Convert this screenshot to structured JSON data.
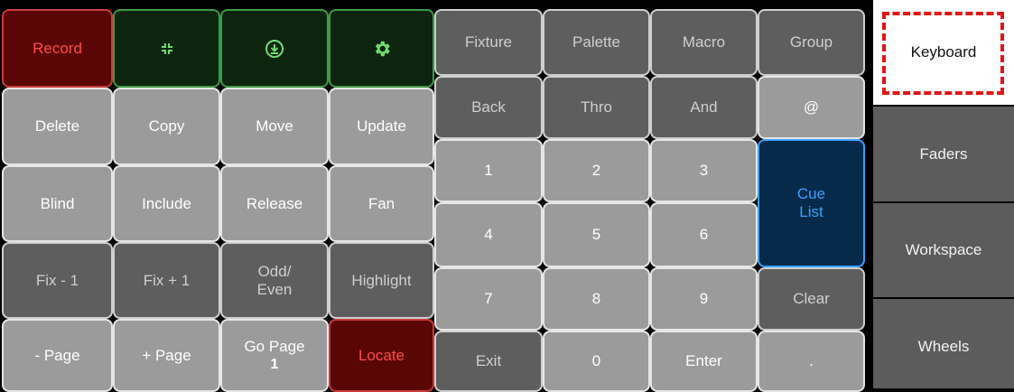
{
  "left_grid": {
    "row1": {
      "record_label": "Record",
      "icon1": "compress-icon",
      "icon2": "download-circle-icon",
      "icon3": "gear-icon"
    },
    "row2": [
      "Delete",
      "Copy",
      "Move",
      "Update"
    ],
    "row3": [
      "Blind",
      "Include",
      "Release",
      "Fan"
    ],
    "row4": [
      "Fix - 1",
      "Fix + 1",
      "Odd/\nEven",
      "Highlight"
    ],
    "row5": {
      "page_minus": "- Page",
      "page_plus": "+ Page",
      "go_page": "Go Page",
      "go_page_value": "1",
      "locate": "Locate"
    }
  },
  "keypad": {
    "row1": [
      "Fixture",
      "Palette",
      "Macro",
      "Group"
    ],
    "row2": [
      "Back",
      "Thro",
      "And",
      "@"
    ],
    "row3": [
      "1",
      "2",
      "3"
    ],
    "row4": [
      "4",
      "5",
      "6"
    ],
    "row5": [
      "7",
      "8",
      "9"
    ],
    "row6": [
      "Exit",
      "0",
      "Enter",
      "."
    ],
    "cue_list": "Cue\nList",
    "clear": "Clear"
  },
  "sidebar": {
    "items": [
      "Keyboard",
      "Faders",
      "Workspace",
      "Wheels"
    ],
    "active": "Keyboard"
  },
  "colors": {
    "record_red": "#5a0606",
    "green_dark": "#0d240f",
    "cue_blue": "#062a4a"
  }
}
